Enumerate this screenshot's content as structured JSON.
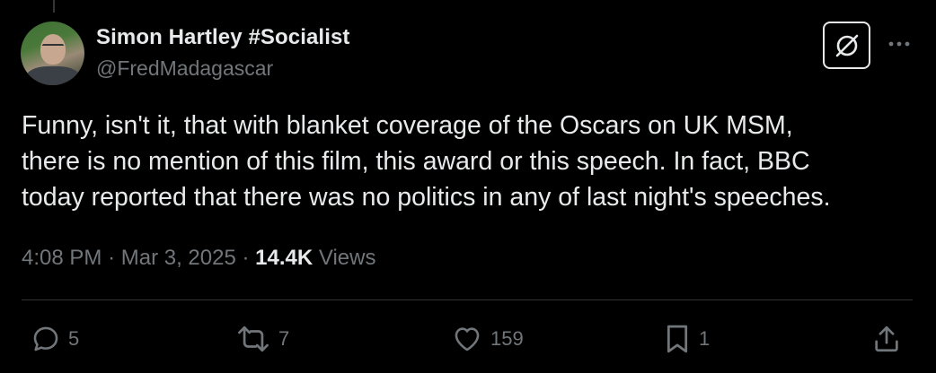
{
  "author": {
    "display_name": "Simon Hartley #Socialist",
    "handle": "@FredMadagascar"
  },
  "tweet": {
    "text_lines": [
      "Funny, isn't it, that with blanket coverage of the Oscars on UK MSM,",
      "there is no mention of this film, this award or this speech. In fact, BBC",
      "today reported that there was no politics in any of last night's speeches."
    ]
  },
  "meta": {
    "time": "4:08 PM",
    "separator": "·",
    "date": "Mar 3, 2025",
    "views_count": "14.4K",
    "views_label": "Views"
  },
  "actions": {
    "reply_count": "5",
    "repost_count": "7",
    "like_count": "159",
    "bookmark_count": "1"
  },
  "icons": {
    "grok": "grok-icon",
    "more": "more-dots-icon",
    "reply": "reply-bubble-icon",
    "repost": "repost-arrows-icon",
    "like": "heart-icon",
    "bookmark": "bookmark-icon",
    "share": "share-upload-icon"
  },
  "colors": {
    "background": "#000000",
    "text_primary": "#e7e9ea",
    "text_secondary": "#71767b",
    "divider": "#2f3336"
  }
}
